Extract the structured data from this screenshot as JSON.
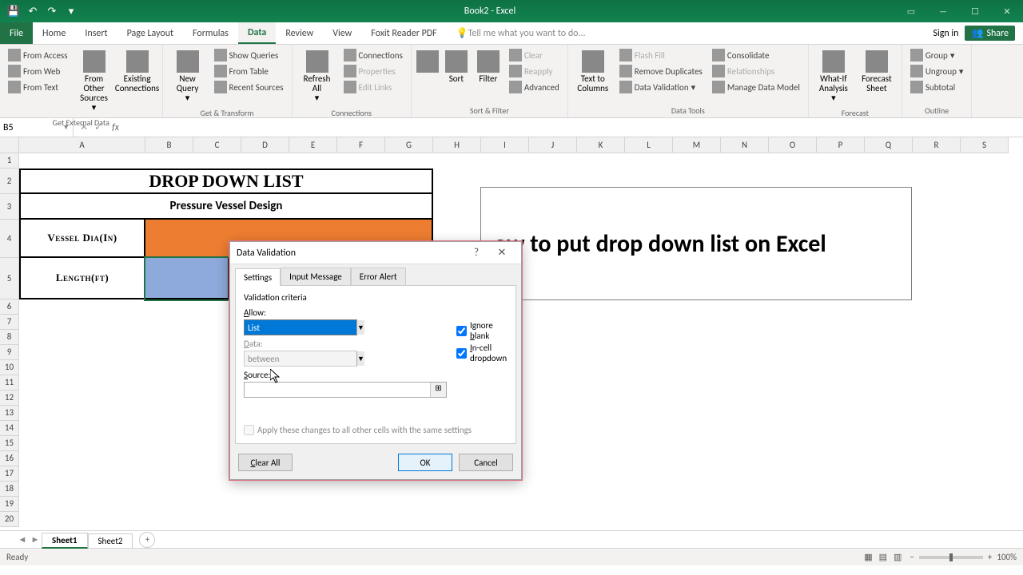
{
  "titlebar": {
    "title": "Book2 - Excel"
  },
  "tabs": {
    "file": "File",
    "home": "Home",
    "insert": "Insert",
    "pageLayout": "Page Layout",
    "formulas": "Formulas",
    "data": "Data",
    "review": "Review",
    "view": "View",
    "foxit": "Foxit Reader PDF",
    "tellme": "Tell me what you want to do...",
    "signin": "Sign in",
    "share": "Share"
  },
  "ribbon": {
    "g1": {
      "label": "Get External Data",
      "fromAccess": "From Access",
      "fromWeb": "From Web",
      "fromText": "From Text",
      "fromOther": "From Other Sources",
      "existing": "Existing Connections"
    },
    "g2": {
      "label": "Get & Transform",
      "newQuery": "New Query",
      "showQueries": "Show Queries",
      "fromTable": "From Table",
      "recentSources": "Recent Sources"
    },
    "g3": {
      "label": "Connections",
      "refreshAll": "Refresh All",
      "connections": "Connections",
      "properties": "Properties",
      "editLinks": "Edit Links"
    },
    "g4": {
      "label": "Sort & Filter",
      "sort": "Sort",
      "filter": "Filter",
      "clear": "Clear",
      "reapply": "Reapply",
      "advanced": "Advanced"
    },
    "g5": {
      "label": "Data Tools",
      "textToCols": "Text to Columns",
      "flashFill": "Flash Fill",
      "removeDup": "Remove Duplicates",
      "dataValidation": "Data Validation",
      "consolidate": "Consolidate",
      "relationships": "Relationships",
      "manageModel": "Manage Data Model"
    },
    "g6": {
      "label": "Forecast",
      "whatIf": "What-If Analysis",
      "forecast": "Forecast Sheet"
    },
    "g7": {
      "label": "Outline",
      "group": "Group",
      "ungroup": "Ungroup",
      "subtotal": "Subtotal"
    }
  },
  "nameBox": "B5",
  "colHeaders": [
    "A",
    "B",
    "C",
    "D",
    "E",
    "F",
    "G",
    "H",
    "I",
    "J",
    "K",
    "L",
    "M",
    "N",
    "O",
    "P",
    "Q",
    "R",
    "S"
  ],
  "rowCount": 20,
  "worksheet": {
    "title": "DROP DOWN LIST",
    "subtitle": "Pressure Vessel Design",
    "row4": "Vessel Dia(In)",
    "row5": "Length(ft)"
  },
  "textbox": "ow to put drop down list on Excel",
  "dialog": {
    "title": "Data Validation",
    "tabs": {
      "settings": "Settings",
      "input": "Input Message",
      "error": "Error Alert"
    },
    "criteria": "Validation criteria",
    "allow": "Allow:",
    "allowValue": "List",
    "data": "Data:",
    "dataValue": "between",
    "source": "Source:",
    "sourceValue": "",
    "ignoreBlank": "Ignore blank",
    "incell": "In-cell dropdown",
    "apply": "Apply these changes to all other cells with the same settings",
    "clearAll": "Clear All",
    "ok": "OK",
    "cancel": "Cancel"
  },
  "sheets": {
    "s1": "Sheet1",
    "s2": "Sheet2"
  },
  "status": {
    "ready": "Ready",
    "zoom": "100%"
  },
  "colWidths": {
    "A": 158,
    "B": 60,
    "C": 60,
    "D": 60,
    "E": 60,
    "F": 60,
    "G": 60,
    "H": 60,
    "I": 60,
    "J": 60,
    "K": 60,
    "L": 60,
    "M": 60,
    "N": 60,
    "O": 60,
    "P": 60,
    "Q": 60,
    "R": 60,
    "S": 60
  },
  "rowHeights": {
    "1": 19,
    "2": 32,
    "3": 32,
    "4": 48,
    "5": 52
  }
}
